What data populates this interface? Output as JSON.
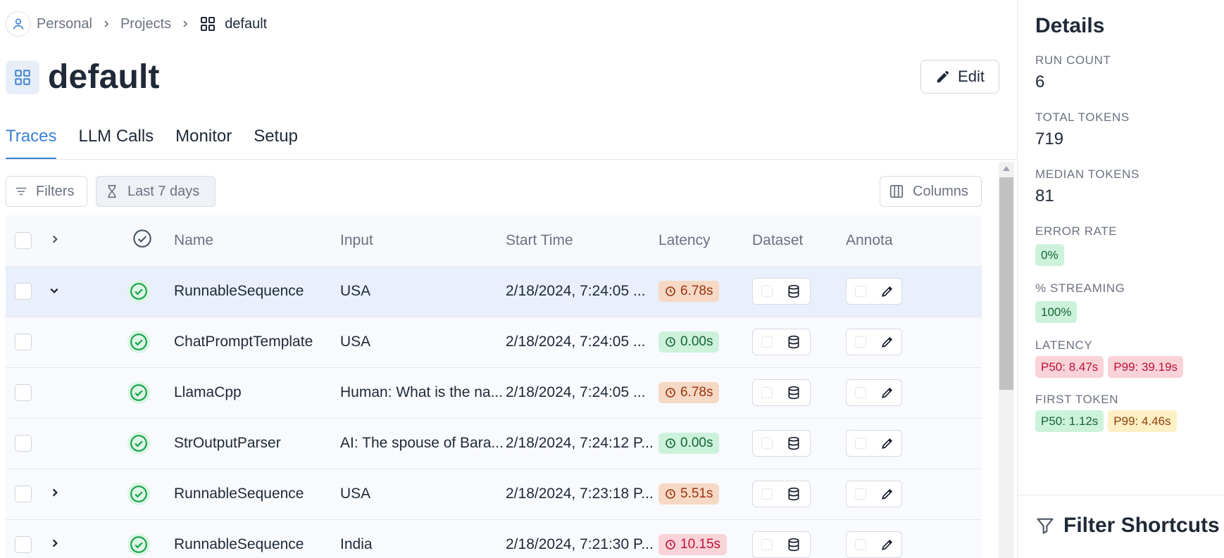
{
  "breadcrumb": {
    "items": [
      "Personal",
      "Projects"
    ],
    "current": "default"
  },
  "page": {
    "title": "default",
    "edit_label": "Edit"
  },
  "tabs": [
    {
      "label": "Traces"
    },
    {
      "label": "LLM Calls"
    },
    {
      "label": "Monitor"
    },
    {
      "label": "Setup"
    }
  ],
  "toolbar": {
    "filters_label": "Filters",
    "date_range_label": "Last 7 days",
    "columns_label": "Columns"
  },
  "table": {
    "columns": {
      "name": "Name",
      "input": "Input",
      "start_time": "Start Time",
      "latency": "Latency",
      "dataset": "Dataset",
      "annotations": "Annota"
    },
    "rows": [
      {
        "name": "RunnableSequence",
        "input": "USA",
        "start_time": "2/18/2024, 7:24:05 ...",
        "latency": "6.78s",
        "latency_level": "orange",
        "expander": "expanded"
      },
      {
        "name": "ChatPromptTemplate",
        "input": "USA",
        "start_time": "2/18/2024, 7:24:05 ...",
        "latency": "0.00s",
        "latency_level": "green",
        "expander": "none"
      },
      {
        "name": "LlamaCpp",
        "input": "Human: What is the na...",
        "start_time": "2/18/2024, 7:24:05 ...",
        "latency": "6.78s",
        "latency_level": "orange",
        "expander": "none"
      },
      {
        "name": "StrOutputParser",
        "input": "AI: The spouse of Bara...",
        "start_time": "2/18/2024, 7:24:12 P...",
        "latency": "0.00s",
        "latency_level": "green",
        "expander": "none"
      },
      {
        "name": "RunnableSequence",
        "input": "USA",
        "start_time": "2/18/2024, 7:23:18 P...",
        "latency": "5.51s",
        "latency_level": "orange",
        "expander": "collapsed"
      },
      {
        "name": "RunnableSequence",
        "input": "India",
        "start_time": "2/18/2024, 7:21:30 P...",
        "latency": "10.15s",
        "latency_level": "red",
        "expander": "collapsed"
      }
    ]
  },
  "details": {
    "title": "Details",
    "run_count_label": "RUN COUNT",
    "run_count": "6",
    "total_tokens_label": "TOTAL TOKENS",
    "total_tokens": "719",
    "median_tokens_label": "MEDIAN TOKENS",
    "median_tokens": "81",
    "error_rate_label": "ERROR RATE",
    "error_rate": "0%",
    "streaming_label": "% STREAMING",
    "streaming": "100%",
    "latency_label": "LATENCY",
    "latency_p50": "P50: 8.47s",
    "latency_p99": "P99: 39.19s",
    "first_token_label": "FIRST TOKEN",
    "first_token_p50": "P50: 1.12s",
    "first_token_p99": "P99: 4.46s",
    "filter_shortcuts_title": "Filter Shortcuts"
  },
  "colors": {
    "accent": "#3b82d6",
    "success": "#16a34a",
    "warning_bg": "#f6d9c4",
    "error_bg": "#f9d3d8"
  },
  "icons": [
    "user-icon",
    "chevron-right-icon",
    "grid-icon",
    "pencil-icon",
    "filter-lines-icon",
    "hourglass-icon",
    "columns-icon",
    "check-circle-icon",
    "clock-icon",
    "database-icon",
    "filter-funnel-icon"
  ]
}
